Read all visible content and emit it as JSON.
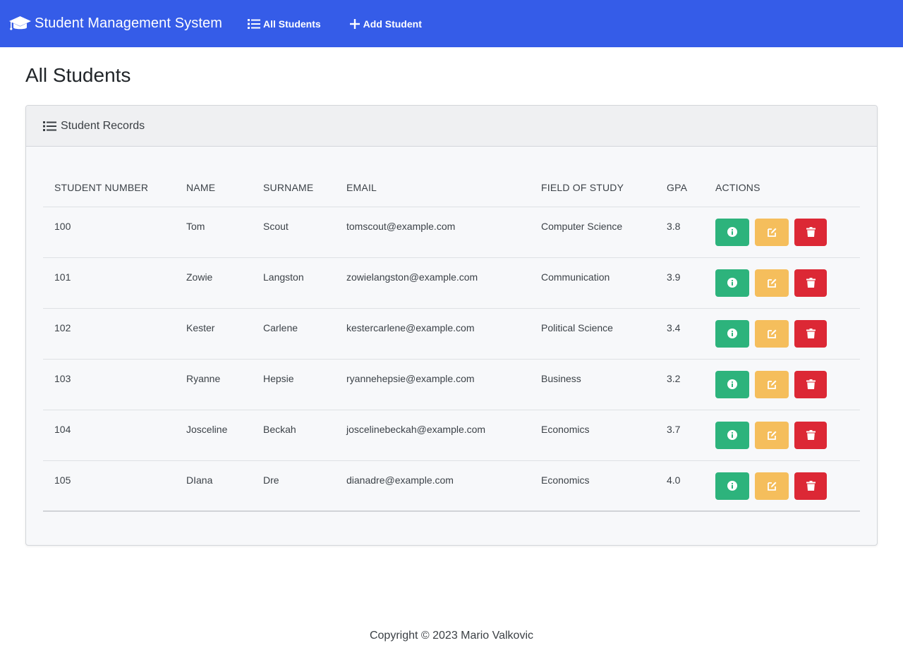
{
  "nav": {
    "brand": "Student Management System",
    "all_students": "All Students",
    "add_student": "Add Student"
  },
  "page": {
    "title": "All Students"
  },
  "card": {
    "header": "Student Records"
  },
  "table": {
    "columns": [
      "STUDENT NUMBER",
      "NAME",
      "SURNAME",
      "EMAIL",
      "FIELD OF STUDY",
      "GPA",
      "ACTIONS"
    ],
    "rows": [
      {
        "number": "100",
        "name": "Tom",
        "surname": "Scout",
        "email": "tomscout@example.com",
        "field": "Computer Science",
        "gpa": "3.8"
      },
      {
        "number": "101",
        "name": "Zowie",
        "surname": "Langston",
        "email": "zowielangston@example.com",
        "field": "Communication",
        "gpa": "3.9"
      },
      {
        "number": "102",
        "name": "Kester",
        "surname": "Carlene",
        "email": "kestercarlene@example.com",
        "field": "Political Science",
        "gpa": "3.4"
      },
      {
        "number": "103",
        "name": "Ryanne",
        "surname": "Hepsie",
        "email": "ryannehepsie@example.com",
        "field": "Business",
        "gpa": "3.2"
      },
      {
        "number": "104",
        "name": "Josceline",
        "surname": "Beckah",
        "email": "joscelinebeckah@example.com",
        "field": "Economics",
        "gpa": "3.7"
      },
      {
        "number": "105",
        "name": "DIana",
        "surname": "Dre",
        "email": "dianadre@example.com",
        "field": "Economics",
        "gpa": "4.0"
      }
    ]
  },
  "footer": {
    "text": "Copyright © 2023 Mario Valkovic"
  },
  "colors": {
    "navbar": "#355ce8",
    "info": "#2db37c",
    "edit": "#f5be5c",
    "delete": "#dc2835"
  },
  "icons": {
    "brand": "graduation-cap-icon",
    "list": "list-icon",
    "add": "plus-icon",
    "info": "info-circle-icon",
    "edit": "edit-icon",
    "delete": "trash-icon"
  }
}
